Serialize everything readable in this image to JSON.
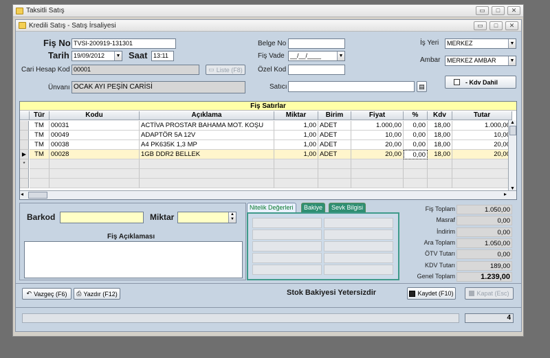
{
  "outer_window": {
    "title": "Taksitli Satış"
  },
  "inner_window": {
    "title": "Kredili Satış - Satış İrsaliyesi"
  },
  "header": {
    "fis_no_label": "Fiş No",
    "fis_no": "TVSI-200919-131301",
    "tarih_label": "Tarih",
    "tarih": "19/09/2012",
    "saat_label": "Saat",
    "saat": "13:11",
    "cari_label": "Cari Hesap Kod",
    "cari": "00001",
    "liste_label": "Liste (F8)",
    "unvan_label": "Ünvanı",
    "unvan": "OCAK AYI PEŞİN CARİSİ",
    "belge_no_label": "Belge No",
    "belge_no": "",
    "fis_vade_label": "Fiş Vade",
    "fis_vade": "__/__/____",
    "ozel_kod_label": "Özel Kod",
    "ozel_kod": "",
    "satici_label": "Satıcı",
    "satici": "",
    "is_yeri_label": "İş Yeri",
    "is_yeri": "MERKEZ",
    "ambar_label": "Ambar",
    "ambar": "MERKEZ AMBAR",
    "kdv_dahil_label": "- Kdv Dahil"
  },
  "grid": {
    "title": "Fiş Satırlar",
    "columns": [
      "Tür",
      "Kodu",
      "Açıklama",
      "Miktar",
      "Birim",
      "Fiyat",
      "%",
      "Kdv",
      "Tutar"
    ],
    "rows": [
      [
        "TM",
        "00031",
        "ACTİVA PROSTAR BAHAMA MOT. KOŞU",
        "1,00",
        "ADET",
        "1.000,00",
        "0,00",
        "18,00",
        "1.000,00"
      ],
      [
        "TM",
        "00049",
        "ADAPTÖR 5A 12V",
        "1,00",
        "ADET",
        "10,00",
        "0,00",
        "18,00",
        "10,00"
      ],
      [
        "TM",
        "00038",
        "A4 PK635K 1,3 MP",
        "1,00",
        "ADET",
        "20,00",
        "0,00",
        "18,00",
        "20,00"
      ],
      [
        "TM",
        "00028",
        "1GB DDR2 BELLEK",
        "1,00",
        "ADET",
        "20,00",
        "0,00",
        "18,00",
        "20,00"
      ]
    ],
    "new_row_marker": "*",
    "current_row_marker": "▶"
  },
  "entry": {
    "barkod_label": "Barkod",
    "barkod": "",
    "miktar_label": "Miktar",
    "miktar": "",
    "aciklama_label": "Fiş Açıklaması",
    "aciklama": ""
  },
  "tabs": [
    "Nitelik Değerleri",
    "Bakiye",
    "Sevk Bilgisi"
  ],
  "totals": [
    {
      "label": "Fiş Toplam",
      "value": "1.050,00"
    },
    {
      "label": "Masraf",
      "value": "0,00"
    },
    {
      "label": "İndirim",
      "value": "0,00"
    },
    {
      "label": "Ara Toplam",
      "value": "1.050,00"
    },
    {
      "label": "ÖTV Tutarı",
      "value": "0,00"
    },
    {
      "label": "KDV Tutarı",
      "value": "189,00"
    },
    {
      "label": "Genel Toplam",
      "value": "1.239,00"
    }
  ],
  "footer": {
    "vazgec": "Vazgeç (F6)",
    "yazdir": "Yazdır (F12)",
    "message": "Stok Bakiyesi Yetersizdir",
    "kaydet": "Kaydet (F10)",
    "kapat": "Kapat (Esc)",
    "count": "4"
  },
  "icons": {
    "window": "folder-icon",
    "dropdown": "chevron-down-icon",
    "save": "floppy-icon",
    "print": "printer-icon",
    "undo": "undo-icon"
  }
}
